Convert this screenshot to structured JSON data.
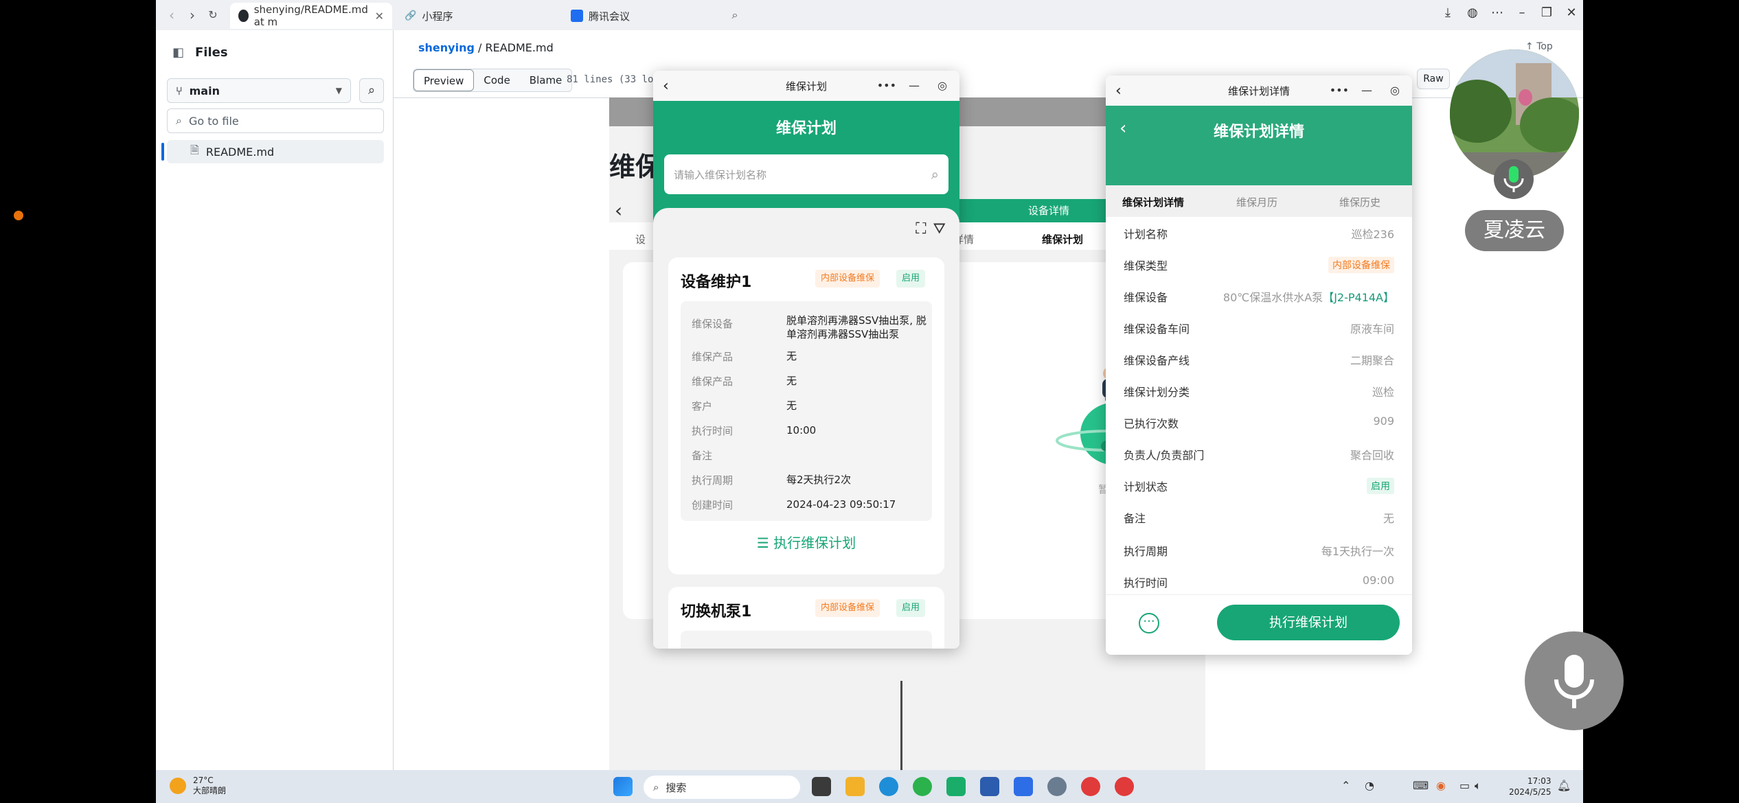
{
  "browser": {
    "tabs": [
      {
        "label": "shenying/README.md at m"
      },
      {
        "label": "小程序"
      },
      {
        "label": "腾讯会议"
      }
    ]
  },
  "github": {
    "files_title": "Files",
    "branch": "main",
    "go_to_file_placeholder": "Go to file",
    "file_name": "README.md",
    "breadcrumb_repo": "shenying",
    "breadcrumb_sep": "/",
    "breadcrumb_file": "README.md",
    "top_label": "Top",
    "view_tabs": [
      "Preview",
      "Code",
      "Blame"
    ],
    "lines_info": "81 lines (33 loc)",
    "raw_label": "Raw"
  },
  "md_image": {
    "heading": "维保",
    "green_tab": "设备详情",
    "tabs": [
      "设",
      "备详情",
      "维保计划"
    ],
    "empty_text": "暂无数据"
  },
  "phone1": {
    "window_title": "维保计划",
    "header_title": "维保计划",
    "search_placeholder": "请输入维保计划名称",
    "cards": [
      {
        "title": "设备维护1",
        "tag_type": "内部设备维保",
        "tag_status": "启用",
        "fields": [
          {
            "k": "维保设备",
            "v": "脱单溶剂再沸器SSV抽出泵, 脱单溶剂再沸器SSV抽出泵"
          },
          {
            "k": "维保产品",
            "v": "无"
          },
          {
            "k": "维保产品",
            "v": "无"
          },
          {
            "k": "客户",
            "v": "无"
          },
          {
            "k": "执行时间",
            "v": "10:00"
          },
          {
            "k": "备注",
            "v": ""
          },
          {
            "k": "执行周期",
            "v": "每2天执行2次"
          },
          {
            "k": "创建时间",
            "v": "2024-04-23 09:50:17"
          }
        ],
        "action": "执行维保计划"
      },
      {
        "title": "切换机泵1",
        "tag_type": "内部设备维保",
        "tag_status": "启用"
      }
    ]
  },
  "phone2": {
    "window_title": "维保计划详情",
    "header_title": "维保计划详情",
    "tabs": [
      "维保计划详情",
      "维保月历",
      "维保历史"
    ],
    "rows": [
      {
        "k": "计划名称",
        "v": "巡检236"
      },
      {
        "k": "维保类型",
        "v": "内部设备维保"
      },
      {
        "k": "维保设备",
        "v": "80℃保温水供水A泵",
        "v2": "【J2-P414A】"
      },
      {
        "k": "维保设备车间",
        "v": "原液车间"
      },
      {
        "k": "维保设备产线",
        "v": "二期聚合"
      },
      {
        "k": "维保计划分类",
        "v": "巡检"
      },
      {
        "k": "已执行次数",
        "v": "909"
      },
      {
        "k": "负责人/负责部门",
        "v": "聚合回收"
      },
      {
        "k": "计划状态",
        "v": "启用"
      },
      {
        "k": "备注",
        "v": "无"
      },
      {
        "k": "执行周期",
        "v": "每1天执行一次"
      },
      {
        "k": "执行时间",
        "v": "09:00"
      }
    ],
    "execute_label": "执行维保计划"
  },
  "meeting": {
    "participant_name": "夏凌云"
  },
  "taskbar": {
    "weather_temp": "27°C",
    "weather_desc": "大部晴朗",
    "search_label": "搜索",
    "time": "17:03",
    "date": "2024/5/25"
  },
  "colors": {
    "brand_green": "#18a676",
    "tag_orange": "#f27b22"
  }
}
